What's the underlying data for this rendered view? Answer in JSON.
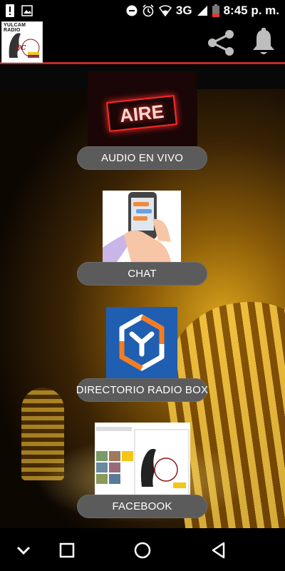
{
  "status_bar": {
    "time": "8:45 p. m.",
    "network": "3G"
  },
  "app_bar": {
    "logo": {
      "title": "YULCAM RADIO",
      "monogram": "yc"
    },
    "share_icon": "share-icon",
    "bell_icon": "bell-icon",
    "accent_color": "#c62828"
  },
  "menu": {
    "items": [
      {
        "label": "AUDIO EN VIVO",
        "image": "aire-on-air-sign",
        "image_text": "AIRE"
      },
      {
        "label": "CHAT",
        "image": "hand-holding-phone"
      },
      {
        "label": "DIRECTORIO RADIO BOX",
        "image": "radio-box-hexagon-logo"
      },
      {
        "label": "FACEBOOK",
        "image": "facebook-page-screenshot"
      }
    ]
  },
  "nav_bar": {
    "buttons": [
      "chevron-down-icon",
      "square-icon",
      "circle-home-icon",
      "triangle-back-icon"
    ]
  }
}
